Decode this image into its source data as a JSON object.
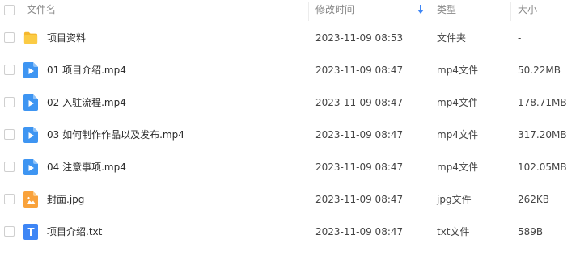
{
  "header": {
    "col_name": "文件名",
    "col_time": "修改时间",
    "col_type": "类型",
    "col_size": "大小"
  },
  "colors": {
    "folder": "#F9C43A",
    "video": "#3E95F2",
    "image": "#F9A23B",
    "text": "#3E86F5",
    "sort_arrow": "#3E86F5"
  },
  "rows": [
    {
      "icon": "folder-icon",
      "name": "项目资料",
      "time": "2023-11-09 08:53",
      "type": "文件夹",
      "size": "-"
    },
    {
      "icon": "video-file-icon",
      "name": "01 项目介绍.mp4",
      "time": "2023-11-09 08:47",
      "type": "mp4文件",
      "size": "50.22MB"
    },
    {
      "icon": "video-file-icon",
      "name": "02 入驻流程.mp4",
      "time": "2023-11-09 08:47",
      "type": "mp4文件",
      "size": "178.71MB"
    },
    {
      "icon": "video-file-icon",
      "name": "03 如何制作作品以及发布.mp4",
      "time": "2023-11-09 08:47",
      "type": "mp4文件",
      "size": "317.20MB"
    },
    {
      "icon": "video-file-icon",
      "name": "04 注意事项.mp4",
      "time": "2023-11-09 08:47",
      "type": "mp4文件",
      "size": "102.05MB"
    },
    {
      "icon": "image-file-icon",
      "name": "封面.jpg",
      "time": "2023-11-09 08:47",
      "type": "jpg文件",
      "size": "262KB"
    },
    {
      "icon": "text-file-icon",
      "name": "项目介绍.txt",
      "time": "2023-11-09 08:47",
      "type": "txt文件",
      "size": "589B"
    }
  ]
}
